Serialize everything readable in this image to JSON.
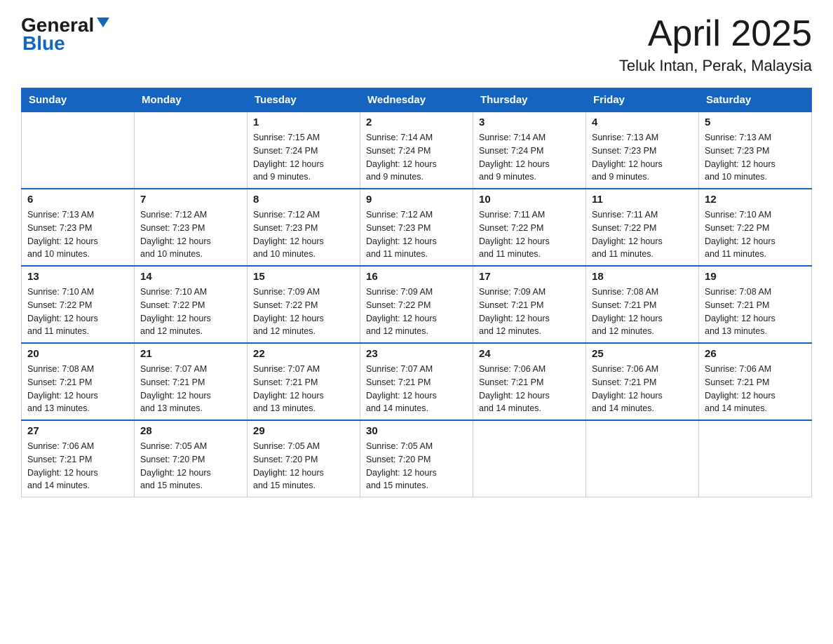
{
  "header": {
    "logo_general": "General",
    "logo_blue": "Blue",
    "title": "April 2025",
    "subtitle": "Teluk Intan, Perak, Malaysia"
  },
  "calendar": {
    "days_of_week": [
      "Sunday",
      "Monday",
      "Tuesday",
      "Wednesday",
      "Thursday",
      "Friday",
      "Saturday"
    ],
    "weeks": [
      [
        {
          "day": "",
          "info": ""
        },
        {
          "day": "",
          "info": ""
        },
        {
          "day": "1",
          "info": "Sunrise: 7:15 AM\nSunset: 7:24 PM\nDaylight: 12 hours\nand 9 minutes."
        },
        {
          "day": "2",
          "info": "Sunrise: 7:14 AM\nSunset: 7:24 PM\nDaylight: 12 hours\nand 9 minutes."
        },
        {
          "day": "3",
          "info": "Sunrise: 7:14 AM\nSunset: 7:24 PM\nDaylight: 12 hours\nand 9 minutes."
        },
        {
          "day": "4",
          "info": "Sunrise: 7:13 AM\nSunset: 7:23 PM\nDaylight: 12 hours\nand 9 minutes."
        },
        {
          "day": "5",
          "info": "Sunrise: 7:13 AM\nSunset: 7:23 PM\nDaylight: 12 hours\nand 10 minutes."
        }
      ],
      [
        {
          "day": "6",
          "info": "Sunrise: 7:13 AM\nSunset: 7:23 PM\nDaylight: 12 hours\nand 10 minutes."
        },
        {
          "day": "7",
          "info": "Sunrise: 7:12 AM\nSunset: 7:23 PM\nDaylight: 12 hours\nand 10 minutes."
        },
        {
          "day": "8",
          "info": "Sunrise: 7:12 AM\nSunset: 7:23 PM\nDaylight: 12 hours\nand 10 minutes."
        },
        {
          "day": "9",
          "info": "Sunrise: 7:12 AM\nSunset: 7:23 PM\nDaylight: 12 hours\nand 11 minutes."
        },
        {
          "day": "10",
          "info": "Sunrise: 7:11 AM\nSunset: 7:22 PM\nDaylight: 12 hours\nand 11 minutes."
        },
        {
          "day": "11",
          "info": "Sunrise: 7:11 AM\nSunset: 7:22 PM\nDaylight: 12 hours\nand 11 minutes."
        },
        {
          "day": "12",
          "info": "Sunrise: 7:10 AM\nSunset: 7:22 PM\nDaylight: 12 hours\nand 11 minutes."
        }
      ],
      [
        {
          "day": "13",
          "info": "Sunrise: 7:10 AM\nSunset: 7:22 PM\nDaylight: 12 hours\nand 11 minutes."
        },
        {
          "day": "14",
          "info": "Sunrise: 7:10 AM\nSunset: 7:22 PM\nDaylight: 12 hours\nand 12 minutes."
        },
        {
          "day": "15",
          "info": "Sunrise: 7:09 AM\nSunset: 7:22 PM\nDaylight: 12 hours\nand 12 minutes."
        },
        {
          "day": "16",
          "info": "Sunrise: 7:09 AM\nSunset: 7:22 PM\nDaylight: 12 hours\nand 12 minutes."
        },
        {
          "day": "17",
          "info": "Sunrise: 7:09 AM\nSunset: 7:21 PM\nDaylight: 12 hours\nand 12 minutes."
        },
        {
          "day": "18",
          "info": "Sunrise: 7:08 AM\nSunset: 7:21 PM\nDaylight: 12 hours\nand 12 minutes."
        },
        {
          "day": "19",
          "info": "Sunrise: 7:08 AM\nSunset: 7:21 PM\nDaylight: 12 hours\nand 13 minutes."
        }
      ],
      [
        {
          "day": "20",
          "info": "Sunrise: 7:08 AM\nSunset: 7:21 PM\nDaylight: 12 hours\nand 13 minutes."
        },
        {
          "day": "21",
          "info": "Sunrise: 7:07 AM\nSunset: 7:21 PM\nDaylight: 12 hours\nand 13 minutes."
        },
        {
          "day": "22",
          "info": "Sunrise: 7:07 AM\nSunset: 7:21 PM\nDaylight: 12 hours\nand 13 minutes."
        },
        {
          "day": "23",
          "info": "Sunrise: 7:07 AM\nSunset: 7:21 PM\nDaylight: 12 hours\nand 14 minutes."
        },
        {
          "day": "24",
          "info": "Sunrise: 7:06 AM\nSunset: 7:21 PM\nDaylight: 12 hours\nand 14 minutes."
        },
        {
          "day": "25",
          "info": "Sunrise: 7:06 AM\nSunset: 7:21 PM\nDaylight: 12 hours\nand 14 minutes."
        },
        {
          "day": "26",
          "info": "Sunrise: 7:06 AM\nSunset: 7:21 PM\nDaylight: 12 hours\nand 14 minutes."
        }
      ],
      [
        {
          "day": "27",
          "info": "Sunrise: 7:06 AM\nSunset: 7:21 PM\nDaylight: 12 hours\nand 14 minutes."
        },
        {
          "day": "28",
          "info": "Sunrise: 7:05 AM\nSunset: 7:20 PM\nDaylight: 12 hours\nand 15 minutes."
        },
        {
          "day": "29",
          "info": "Sunrise: 7:05 AM\nSunset: 7:20 PM\nDaylight: 12 hours\nand 15 minutes."
        },
        {
          "day": "30",
          "info": "Sunrise: 7:05 AM\nSunset: 7:20 PM\nDaylight: 12 hours\nand 15 minutes."
        },
        {
          "day": "",
          "info": ""
        },
        {
          "day": "",
          "info": ""
        },
        {
          "day": "",
          "info": ""
        }
      ]
    ]
  }
}
